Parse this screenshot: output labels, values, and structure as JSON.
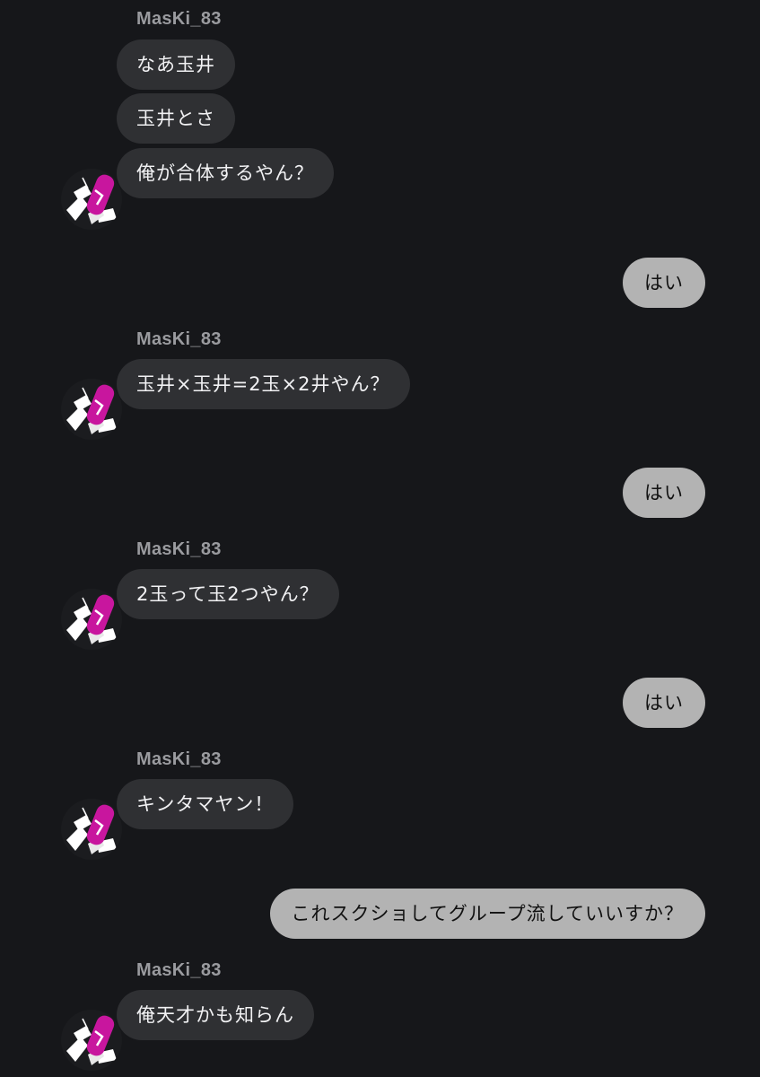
{
  "conversation": {
    "sender_name": "MasKi_83",
    "groups": [
      {
        "sender": "MasKi_83",
        "messages": [
          "なあ玉井",
          "玉井とさ",
          "俺が合体するやん？"
        ]
      },
      {
        "reply": "はい"
      },
      {
        "sender": "MasKi_83",
        "messages": [
          "玉井×玉井=2玉×2井やん？"
        ]
      },
      {
        "reply": "はい"
      },
      {
        "sender": "MasKi_83",
        "messages": [
          "2玉って玉2つやん？"
        ]
      },
      {
        "reply": "はい"
      },
      {
        "sender": "MasKi_83",
        "messages": [
          "キンタマヤン！"
        ]
      },
      {
        "reply": "これスクショしてグループ流していいすか？"
      },
      {
        "sender": "MasKi_83",
        "messages": [
          "俺天才かも知らん"
        ]
      }
    ]
  },
  "colors": {
    "background": "#16171a",
    "incoming_bubble": "#2f3033",
    "outgoing_bubble": "#b3b3b3",
    "sender_name": "#9a9b9f",
    "avatar_accent": "#c8169e"
  },
  "icons": {
    "avatar": "profile-avatar-icon"
  }
}
